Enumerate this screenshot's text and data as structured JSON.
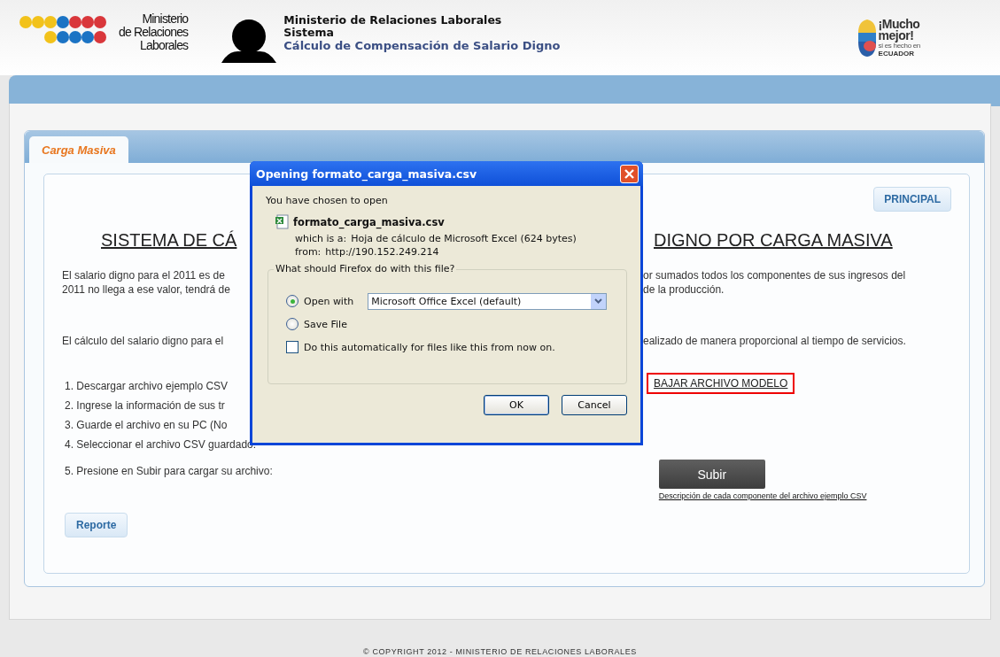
{
  "header": {
    "logo_lines": [
      "Ministerio",
      "de Relaciones",
      "Laborales"
    ],
    "title": "Ministerio de Relaciones Laborales",
    "subtitle": "Sistema",
    "system_name": "Cálculo de Compensación de Salario Digno",
    "brand_lines": [
      "¡Mucho",
      "mejor!",
      "si es hecho en",
      "ECUADOR"
    ]
  },
  "tabs": [
    {
      "label": "Carga Masiva",
      "selected": true
    }
  ],
  "principal_button": "PRINCIPAL",
  "heading": {
    "left": "SISTEMA DE CÁ",
    "right": "DIGNO POR CARGA MASIVA"
  },
  "paragraphs": [
    {
      "left": [
        "El salario digno para el 2011 es de",
        "2011 no llega a ese valor, tendrá de"
      ],
      "right": [
        "or sumados todos los componentes de sus ingresos del",
        "de la producción."
      ]
    },
    {
      "left": [
        "El cálculo del salario digno para el"
      ],
      "right": [
        "ealizado de manera proporcional al tiempo de servicios."
      ]
    }
  ],
  "steps": [
    {
      "text": "1. Descargar archivo ejemplo CSV",
      "kind": "link",
      "action": "BAJAR ARCHIVO MODELO"
    },
    {
      "text": "2. Ingrese la información de sus tr",
      "kind": "plain"
    },
    {
      "text": "3. Guarde el archivo en su PC (No",
      "kind": "plain"
    },
    {
      "text": "4. Seleccionar el archivo CSV guardado:",
      "kind": "plain"
    },
    {
      "text": "5. Presione en Subir para cargar su archivo:",
      "kind": "upload",
      "action": "Subir",
      "note": "Descripción de cada componente del archivo ejemplo CSV"
    }
  ],
  "report_button": "Reporte",
  "footer": "© COPYRIGHT 2012 - MINISTERIO DE RELACIONES LABORALES",
  "dialog": {
    "title": "Opening formato_carga_masiva.csv",
    "intro": "You have chosen to open",
    "file_name": "formato_carga_masiva.csv",
    "type_label": "which is a:",
    "type_value": "Hoja de cálculo de Microsoft Excel (624 bytes)",
    "from_label": "from:",
    "from_value": "http://190.152.249.214",
    "group_label": "What should Firefox do with this file?",
    "options": [
      {
        "label": "Open with",
        "selected": true
      },
      {
        "label": "Save File",
        "selected": false
      }
    ],
    "application": "Microsoft Office Excel (default)",
    "auto": {
      "label": "Do this automatically for files like this from now on.",
      "checked": false
    },
    "buttons": [
      "OK",
      "Cancel"
    ]
  }
}
